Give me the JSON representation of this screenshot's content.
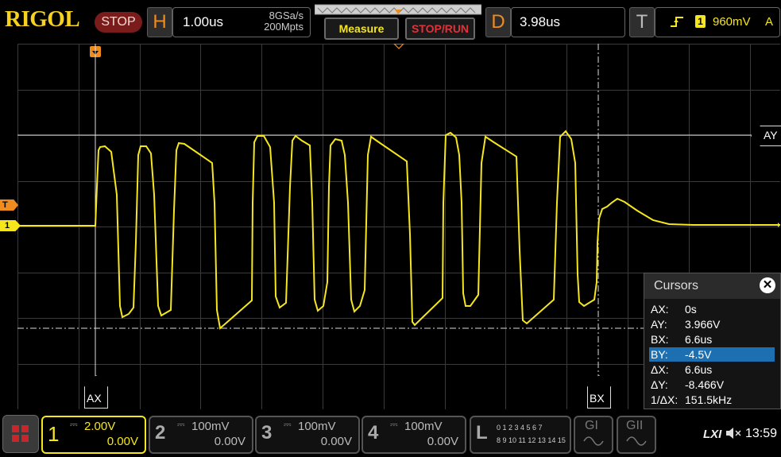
{
  "brand": "RIGOL",
  "run_state": "STOP",
  "horizontal": {
    "letter": "H",
    "timebase": "1.00us",
    "sample_rate": "8GSa/s",
    "memory_depth": "200Mpts"
  },
  "buttons": {
    "measure": "Measure",
    "stop_run": "STOP/RUN"
  },
  "delay": {
    "letter": "D",
    "value": "3.98us"
  },
  "trigger": {
    "letter": "T",
    "channel": "1",
    "level": "960mV",
    "mode": "A"
  },
  "markers": {
    "ay": "AY",
    "ax": "AX",
    "bx": "BX",
    "trig_level": "T",
    "ch1": "1"
  },
  "cursors": {
    "title": "Cursors",
    "close": "✕",
    "rows": [
      {
        "k": "AX:",
        "v": "0s"
      },
      {
        "k": "AY:",
        "v": "3.966V"
      },
      {
        "k": "BX:",
        "v": "6.6us"
      },
      {
        "k": "BY:",
        "v": "-4.5V",
        "selected": true
      },
      {
        "k": "ΔX:",
        "v": "6.6us"
      },
      {
        "k": "ΔY:",
        "v": "-8.466V"
      },
      {
        "k": "1/ΔX:",
        "v": "151.5kHz"
      }
    ]
  },
  "channels": [
    {
      "num": "1",
      "scale": "2.00V",
      "offset": "0.00V",
      "active": true,
      "color": "#f5e61d"
    },
    {
      "num": "2",
      "scale": "100mV",
      "offset": "0.00V",
      "active": false
    },
    {
      "num": "3",
      "scale": "100mV",
      "offset": "0.00V",
      "active": false
    },
    {
      "num": "4",
      "scale": "100mV",
      "offset": "0.00V",
      "active": false
    }
  ],
  "logic": {
    "letter": "L",
    "row1": "0 1 2 3  4 5 6 7",
    "row2": "8 9 10 11 12 13 14 15"
  },
  "gen1": "GI",
  "gen2": "GII",
  "status": {
    "lxi": "LXI",
    "time": "13:59"
  },
  "colors": {
    "ch1": "#f5e61d",
    "accent": "#f08c1e",
    "stop": "#7a1c1c",
    "select": "#1c6fb0"
  }
}
